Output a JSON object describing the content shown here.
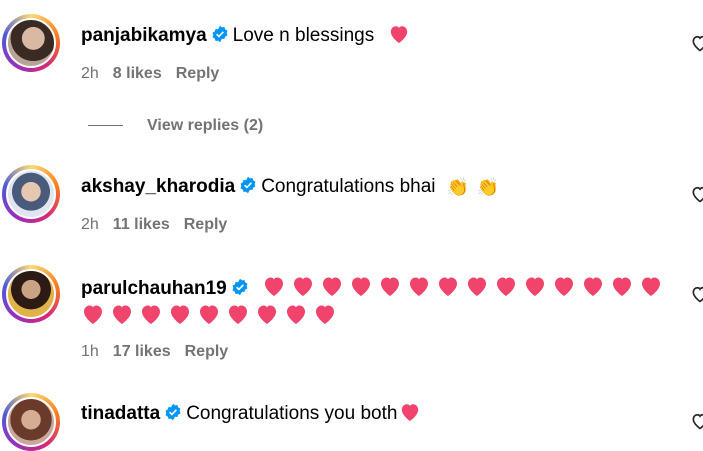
{
  "comments": [
    {
      "username": "panjabikamya",
      "text": "Love n blessings",
      "emoji": "heart",
      "time": "2h",
      "likes": "8 likes",
      "reply": "Reply"
    },
    {
      "username": "akshay_kharodia",
      "text": "Congratulations bhai",
      "emoji": "clapping-hands x2",
      "time": "2h",
      "likes": "11 likes",
      "reply": "Reply"
    },
    {
      "username": "parulchauhan19",
      "text": "",
      "emoji": "heart x23",
      "time": "1h",
      "likes": "17 likes",
      "reply": "Reply"
    },
    {
      "username": "tinadatta",
      "text": "Congratulations you both",
      "emoji": "heart"
    }
  ],
  "view_replies": "View replies (2)",
  "colors": {
    "verified": "#0095f6",
    "heart": "#f0446c",
    "meta": "#737373"
  }
}
